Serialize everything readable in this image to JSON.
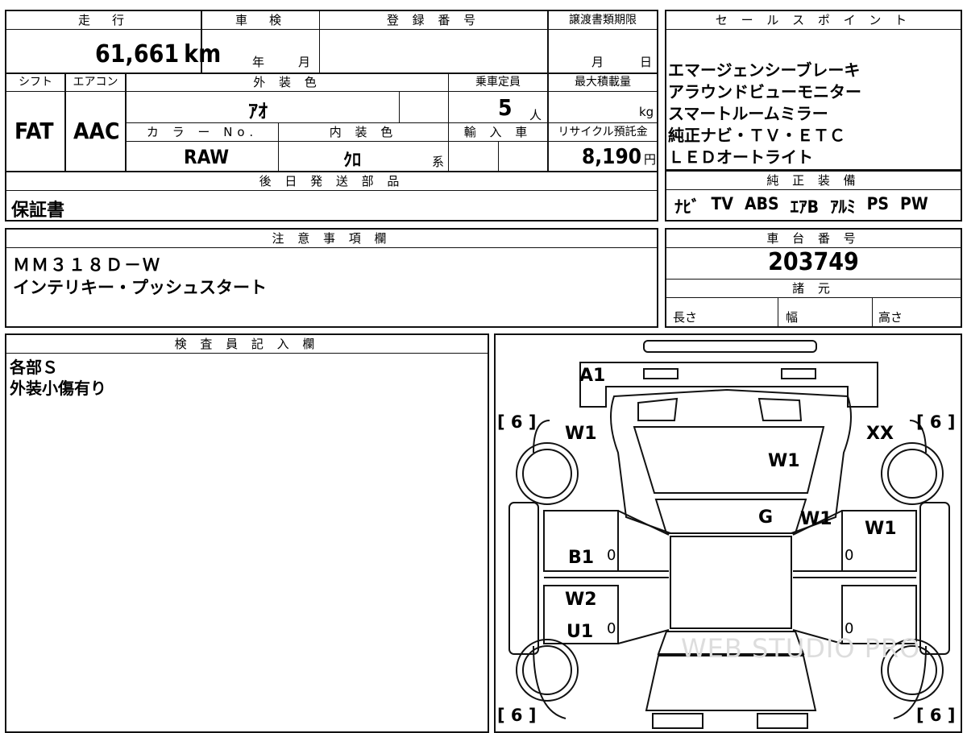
{
  "vehicle": {
    "mileage_label": "走　行",
    "mileage": "61,661",
    "mileage_unit": "km",
    "inspection_label": "車　検",
    "inspection_year": "年",
    "inspection_month": "月",
    "registration_label": "登 録 番 号",
    "transfer_label": "譲渡書類期限",
    "transfer_month": "月",
    "transfer_day": "日",
    "shift_label": "シフト",
    "shift": "FAT",
    "ac_label": "エアコン",
    "ac": "AAC",
    "exterior_color_label": "外 装 色",
    "exterior_color": "ｱｵ",
    "capacity_label": "乗車定員",
    "capacity": "5",
    "capacity_unit": "人",
    "max_load_label": "最大積載量",
    "max_load_unit": "kg",
    "color_no_label": "カ ラ ー No.",
    "color_no": "RAW",
    "interior_color_label": "内 装 色",
    "interior_color": "ｸﾛ",
    "interior_suffix": "系",
    "import_label": "輸 入 車",
    "recycle_label": "リサイクル預託金",
    "recycle_fee": "8,190",
    "recycle_unit": "円",
    "later_parts_label": "後 日 発 送 部 品",
    "later_parts": "保証書"
  },
  "sales_points": {
    "label": "セ ー ル ス ポ イ ン ト",
    "items": [
      "エマージェンシーブレーキ",
      "アラウンドビューモニター",
      "スマートルームミラー",
      "純正ナビ・ＴＶ・ＥＴＣ",
      "ＬＥＤオートライト"
    ]
  },
  "equipment": {
    "label": "純 正 装 備",
    "items": [
      "ﾅﾋﾞ",
      "TV",
      "ABS",
      "ｴｱB",
      "ｱﾙﾐ",
      "PS",
      "PW"
    ]
  },
  "notes": {
    "label": "注 意 事 項 欄",
    "lines": [
      "ＭＭ３１８Ｄ－Ｗ",
      "インテリキー・プッシュスタート"
    ]
  },
  "chassis": {
    "label": "車 台 番 号",
    "number": "203749",
    "specs_label": "諸 元",
    "length": "長さ",
    "width": "幅",
    "height": "高さ"
  },
  "inspector": {
    "label": "検 査 員 記 入 欄",
    "lines": [
      "各部Ｓ",
      "外装小傷有り"
    ]
  },
  "diagram": {
    "tire_labels": [
      "[ 6 ]",
      "[ 6 ]",
      "[ 6 ]",
      "[ 6 ]"
    ],
    "marks": [
      "A1",
      "W1",
      "XX",
      "W1",
      "G",
      "W1",
      "W1",
      "B1",
      "W2",
      "U1"
    ],
    "zeros": [
      "0",
      "0",
      "0",
      "0"
    ],
    "watermark": "WEB STUDIO PRO"
  }
}
